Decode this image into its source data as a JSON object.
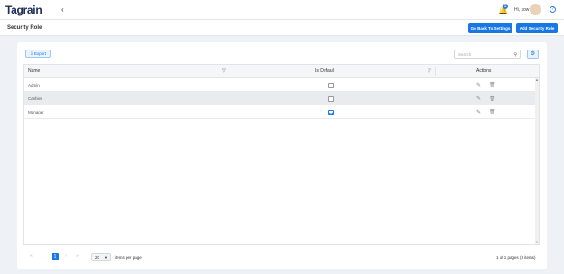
{
  "app": {
    "brand": "Tagrain"
  },
  "topbar": {
    "notif_count": "1",
    "greeting": "Hi, sow"
  },
  "header": {
    "title": "Security Role",
    "back_label": "Go Back To Settings",
    "add_label": "Add Security Role"
  },
  "toolbar": {
    "export_label": "Export",
    "search_placeholder": "Search"
  },
  "grid": {
    "columns": [
      "Name",
      "Is Default",
      "Actions"
    ],
    "rows": [
      {
        "name": "Admin",
        "is_default": false
      },
      {
        "name": "Cashier",
        "is_default": false
      },
      {
        "name": "Manager",
        "is_default": true
      }
    ]
  },
  "pagination": {
    "current_page": "1",
    "page_size": "20",
    "per_page_label": "items per page",
    "info": "1 of 1 pages (3 items)"
  },
  "icons": {
    "collapse": "chevron-left-icon",
    "bell": "bell-icon",
    "help": "help-icon",
    "search": "search-icon",
    "gear": "gear-icon",
    "filter": "filter-icon",
    "edit": "edit-icon",
    "delete": "trash-icon"
  },
  "colors": {
    "accent": "#1677e5",
    "brand": "#1f2d5a"
  }
}
